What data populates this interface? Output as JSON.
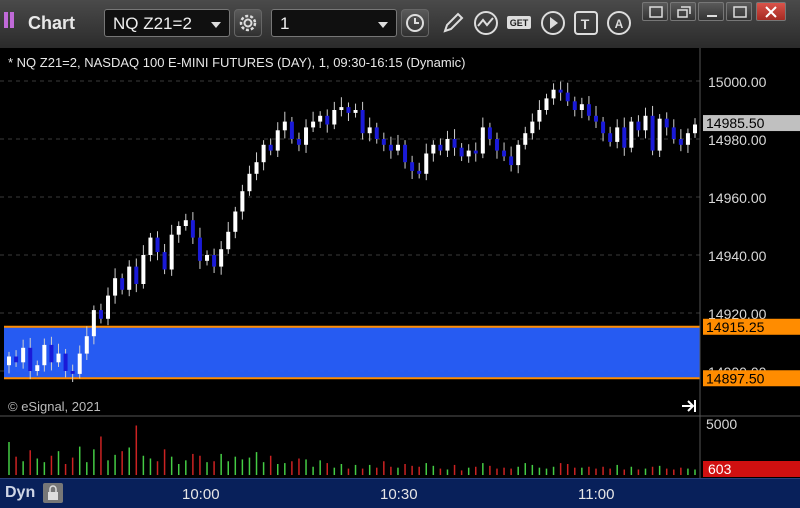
{
  "window": {
    "title": "Chart"
  },
  "toolbar": {
    "symbol": "NQ Z21=2",
    "interval": "1",
    "icons": [
      "clock-icon",
      "pencil-draw-icon",
      "study-wave-icon",
      "get-data-icon",
      "play-icon",
      "text-icon",
      "alert-triangle-icon"
    ]
  },
  "window_controls": [
    "minimize-icon",
    "restore-icon",
    "maximize-icon",
    "close-icon"
  ],
  "chart_header": "* NQ Z21=2, NASDAQ 100 E-MINI FUTURES (DAY), 1, 09:30-16:15 (Dynamic)",
  "copyright": "© eSignal, 2021",
  "footer": {
    "mode": "Dyn"
  },
  "colors": {
    "up": "#ffffff",
    "down": "#1a1ad8",
    "zone": "#2860ff",
    "zone_border": "#ff8c00",
    "vol_up": "#44cc44",
    "vol_down": "#cc2222",
    "bg": "#000000"
  },
  "chart_data": {
    "type": "candlestick",
    "title": "* NQ Z21=2, NASDAQ 100 E-MINI FUTURES (DAY), 1, 09:30-16:15 (Dynamic)",
    "ylim": [
      14880,
      15010
    ],
    "yticks": [
      "15000.00",
      "14980.00",
      "14960.00",
      "14940.00",
      "14920.00",
      "14900.00"
    ],
    "xticks": [
      "10:00",
      "10:30",
      "11:00"
    ],
    "price_labels": {
      "last": "14985.50",
      "zone_top": "14915.25",
      "zone_bottom": "14897.50"
    },
    "zone": {
      "top": 14915.25,
      "bottom": 14897.5
    },
    "volume": {
      "ytick": "5000",
      "last": "603",
      "ymax": 6000
    },
    "closes": [
      14905,
      14903,
      14908,
      14900,
      14902,
      14909,
      14903,
      14906,
      14900,
      14899,
      14906,
      14912,
      14921,
      14918,
      14926,
      14932,
      14928,
      14936,
      14930,
      14940,
      14946,
      14941,
      14935,
      14947,
      14950,
      14952,
      14946,
      14938,
      14940,
      14936,
      14942,
      14948,
      14955,
      14962,
      14968,
      14972,
      14978,
      14976,
      14983,
      14986,
      14980,
      14978,
      14984,
      14986,
      14988,
      14985,
      14990,
      14991,
      14989,
      14990,
      14982,
      14984,
      14980,
      14978,
      14976,
      14978,
      14972,
      14969,
      14968,
      14975,
      14978,
      14976,
      14980,
      14977,
      14974,
      14976,
      14975,
      14984,
      14980,
      14976,
      14974,
      14971,
      14978,
      14982,
      14986,
      14990,
      14994,
      14997,
      14996,
      14993,
      14990,
      14992,
      14988,
      14986,
      14982,
      14979,
      14984,
      14977,
      14986,
      14983,
      14988,
      14976,
      14987,
      14984,
      14980,
      14978,
      14982,
      14985
    ],
    "volumes": [
      3600,
      2000,
      1500,
      2700,
      1800,
      1400,
      2100,
      2600,
      1200,
      1900,
      3100,
      1400,
      2800,
      4200,
      1600,
      2200,
      2600,
      3000,
      5400,
      2100,
      1800,
      1500,
      2800,
      2000,
      1200,
      1600,
      2300,
      2100,
      1400,
      1500,
      2300,
      1500,
      2000,
      1700,
      1900,
      2500,
      1400,
      2100,
      1200,
      1300,
      1500,
      1800,
      1700,
      900,
      1600,
      1300,
      800,
      1200,
      700,
      1100,
      700,
      1100,
      800,
      1500,
      900,
      800,
      1200,
      1000,
      900,
      1300,
      1000,
      700,
      600,
      1100,
      500,
      800,
      900,
      1300,
      1000,
      700,
      800,
      700,
      900,
      1300,
      1100,
      800,
      700,
      900,
      1300,
      1200,
      800,
      800,
      900,
      700,
      900,
      700,
      1100,
      600,
      900,
      600,
      700,
      900,
      1000,
      700,
      600,
      800,
      700,
      600
    ]
  }
}
